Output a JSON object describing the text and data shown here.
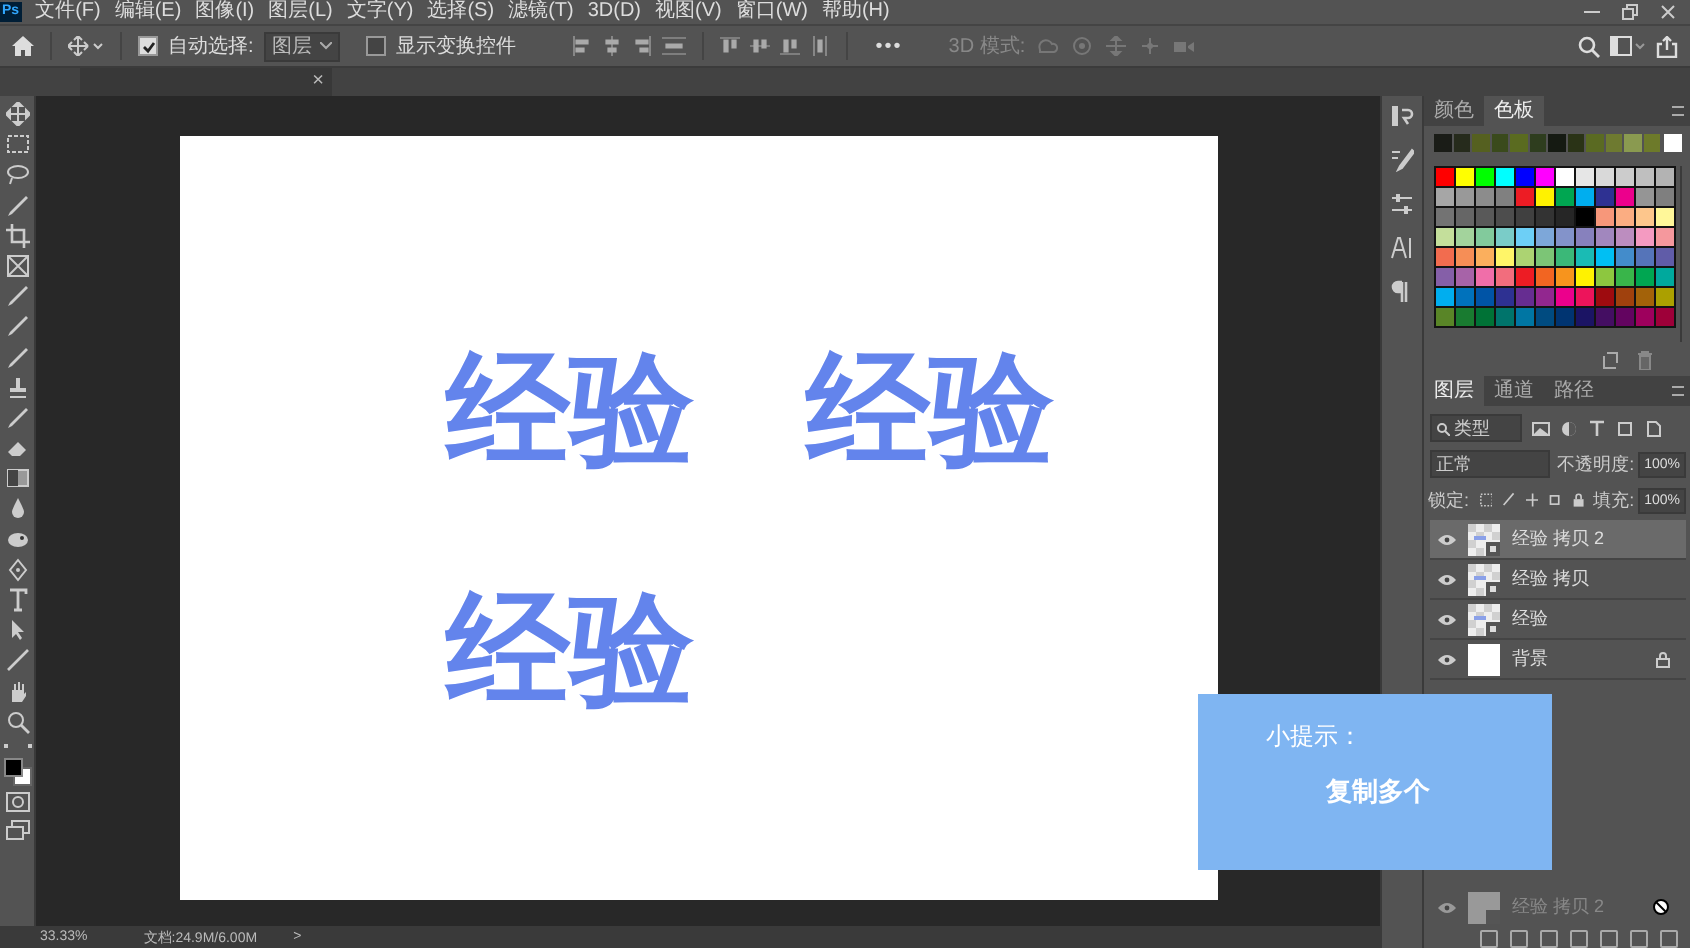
{
  "app_logo": "Ps",
  "menu": [
    "文件(F)",
    "编辑(E)",
    "图像(I)",
    "图层(L)",
    "文字(Y)",
    "选择(S)",
    "滤镜(T)",
    "3D(D)",
    "视图(V)",
    "窗口(W)",
    "帮助(H)"
  ],
  "options_bar": {
    "auto_select": {
      "label": "自动选择:",
      "checked": true
    },
    "auto_select_target": "图层",
    "show_transform": {
      "label": "显示变换控件",
      "checked": false
    },
    "more": "•••",
    "mode_3d": "3D 模式:"
  },
  "document_tab": {
    "close": "×"
  },
  "canvas_texts": [
    "经验",
    "经验",
    "经验"
  ],
  "tip": {
    "title": "小提示：",
    "text": "复制多个"
  },
  "status_bar": {
    "zoom": "33.33%",
    "doc_size": "文档:24.9M/6.00M",
    "arrow": ">"
  },
  "swatches_panel": {
    "tabs": [
      {
        "label": "颜色",
        "selected": false
      },
      {
        "label": "色板",
        "selected": true
      }
    ],
    "recent": [
      {
        "color": "#1a1c17"
      },
      {
        "color": "#262b1c"
      },
      {
        "color": "#556020"
      },
      {
        "color": "#3a4a1c"
      },
      {
        "color": "#5a6b20"
      },
      {
        "color": "#2e3d1e"
      },
      {
        "color": "#151a12"
      },
      {
        "color": "#2a3316"
      },
      {
        "color": "#5a6a22"
      },
      {
        "color": "#6e7a30"
      },
      {
        "color": "#8a9a50"
      },
      {
        "color": "#6d7a2a"
      },
      {
        "color": "#ffffff"
      }
    ],
    "rows": [
      [
        {
          "color": "#ff0000"
        },
        {
          "color": "#ffff00"
        },
        {
          "color": "#00ff00"
        },
        {
          "color": "#00ffff"
        },
        {
          "color": "#0000ff"
        },
        {
          "color": "#ff00ff"
        },
        {
          "color": "#ffffff"
        },
        {
          "color": "#e6e6e6"
        },
        {
          "color": "#d9d9d9"
        },
        {
          "color": "#cccccc"
        },
        {
          "color": "#bfbfbf"
        },
        {
          "color": "#b3b3b3"
        }
      ],
      [
        {
          "color": "#a6a6a6"
        },
        {
          "color": "#999999"
        },
        {
          "color": "#8c8c8c"
        },
        {
          "color": "#808080"
        },
        {
          "color": "#ed1c24"
        },
        {
          "color": "#fff200"
        },
        {
          "color": "#00a651"
        },
        {
          "color": "#00aeef"
        },
        {
          "color": "#2e3192"
        },
        {
          "color": "#ec008c"
        },
        {
          "color": "#959595"
        },
        {
          "color": "#7f7f7f"
        }
      ],
      [
        {
          "color": "#737373"
        },
        {
          "color": "#666666"
        },
        {
          "color": "#595959"
        },
        {
          "color": "#4d4d4d"
        },
        {
          "color": "#404040"
        },
        {
          "color": "#333333"
        },
        {
          "color": "#262626"
        },
        {
          "color": "#000000"
        },
        {
          "color": "#f7977a"
        },
        {
          "color": "#fbad82"
        },
        {
          "color": "#fdc68c"
        },
        {
          "color": "#fff799"
        }
      ],
      [
        {
          "color": "#c4df9b"
        },
        {
          "color": "#a3d39c"
        },
        {
          "color": "#82ca9c"
        },
        {
          "color": "#7accc8"
        },
        {
          "color": "#6dcff6"
        },
        {
          "color": "#7da7d9"
        },
        {
          "color": "#8393ca"
        },
        {
          "color": "#8781bd"
        },
        {
          "color": "#a187be"
        },
        {
          "color": "#bc8dbf"
        },
        {
          "color": "#f49ac1"
        },
        {
          "color": "#f5989d"
        }
      ],
      [
        {
          "color": "#f26c4f"
        },
        {
          "color": "#f68e56"
        },
        {
          "color": "#fbaf5d"
        },
        {
          "color": "#fff568"
        },
        {
          "color": "#acd372"
        },
        {
          "color": "#7cc576"
        },
        {
          "color": "#3bb878"
        },
        {
          "color": "#1abbb4"
        },
        {
          "color": "#00bff3"
        },
        {
          "color": "#438ccb"
        },
        {
          "color": "#5574b9"
        },
        {
          "color": "#605ca8"
        }
      ],
      [
        {
          "color": "#855fa8"
        },
        {
          "color": "#a763a8"
        },
        {
          "color": "#f06ea9"
        },
        {
          "color": "#f26d7d"
        },
        {
          "color": "#ed1c24"
        },
        {
          "color": "#f26522"
        },
        {
          "color": "#f7941d"
        },
        {
          "color": "#fff200"
        },
        {
          "color": "#8dc73f"
        },
        {
          "color": "#39b54a"
        },
        {
          "color": "#00a651"
        },
        {
          "color": "#00a99d"
        }
      ],
      [
        {
          "color": "#00aeef"
        },
        {
          "color": "#0072bc"
        },
        {
          "color": "#0054a6"
        },
        {
          "color": "#2e3192"
        },
        {
          "color": "#662d91"
        },
        {
          "color": "#92278f"
        },
        {
          "color": "#ec008c"
        },
        {
          "color": "#ed145b"
        },
        {
          "color": "#9e0b0f"
        },
        {
          "color": "#a0410d"
        },
        {
          "color": "#a36209"
        },
        {
          "color": "#aba000"
        }
      ],
      [
        {
          "color": "#598527"
        },
        {
          "color": "#197b30"
        },
        {
          "color": "#007236"
        },
        {
          "color": "#00746b"
        },
        {
          "color": "#0076a3"
        },
        {
          "color": "#004b80"
        },
        {
          "color": "#003471"
        },
        {
          "color": "#1b1464"
        },
        {
          "color": "#440e62"
        },
        {
          "color": "#630460"
        },
        {
          "color": "#9e005d"
        },
        {
          "color": "#9e0039"
        }
      ]
    ]
  },
  "layers_panel": {
    "tabs": [
      {
        "label": "图层",
        "selected": true
      },
      {
        "label": "通道",
        "selected": false
      },
      {
        "label": "路径",
        "selected": false
      }
    ],
    "filter": "类型",
    "blend_mode": "正常",
    "opacity_label": "不透明度:",
    "opacity": "100%",
    "lock_label": "锁定:",
    "fill_label": "填充:",
    "fill": "100%",
    "layers": [
      {
        "name": "经验 拷贝 2",
        "kind": "smart",
        "visible": true,
        "selected": true
      },
      {
        "name": "经验 拷贝",
        "kind": "smart",
        "visible": true,
        "selected": false
      },
      {
        "name": "经验",
        "kind": "smart",
        "visible": true,
        "selected": false
      },
      {
        "name": "背景",
        "kind": "background",
        "visible": true,
        "selected": false
      }
    ],
    "dragged_layer": {
      "name": "经验 拷贝 2",
      "kind": "smart"
    }
  }
}
